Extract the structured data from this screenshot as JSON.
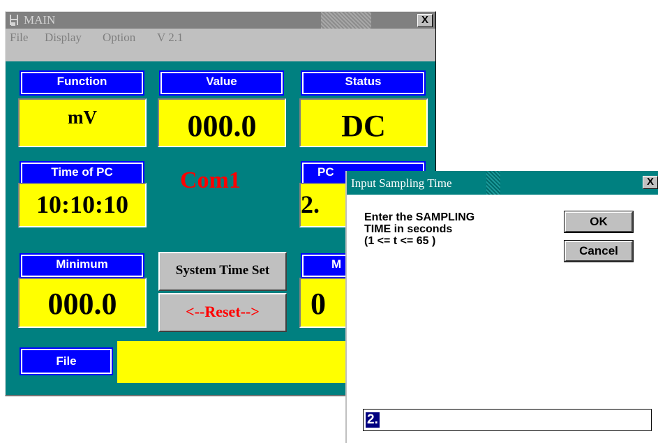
{
  "main_window": {
    "title": "MAIN",
    "close_glyph": "X",
    "menu": [
      "File",
      "Display",
      "Option",
      "V 2.1"
    ]
  },
  "cards": {
    "function": {
      "label": "Function",
      "value": "mV"
    },
    "value": {
      "label": "Value",
      "value": "000.0"
    },
    "status": {
      "label": "Status",
      "value": "DC"
    },
    "time_of_pc": {
      "label": "Time of PC",
      "value": "10:10:10"
    },
    "pc_partial": {
      "label": "PC",
      "value": "2."
    },
    "minimum": {
      "label": "Minimum",
      "value": "000.0"
    },
    "maximum_partial": {
      "label": "M",
      "value": "0"
    },
    "file": {
      "label": "File",
      "value": ""
    }
  },
  "com_port": "Com1",
  "buttons": {
    "system_time_set": "System Time Set",
    "reset": "<--Reset-->"
  },
  "dialog": {
    "title": "Input Sampling Time",
    "close_glyph": "X",
    "prompt_lines": [
      "Enter the SAMPLING",
      "TIME in seconds",
      "(1 <= t <= 65 )"
    ],
    "ok_label": "OK",
    "cancel_label": "Cancel",
    "input_value": "2."
  },
  "colors": {
    "panel": "#008080",
    "label_bg": "#0000ff",
    "value_bg": "#ffff00",
    "com_text": "#ff0000"
  },
  "icons": [
    "app-icon",
    "close-icon"
  ]
}
